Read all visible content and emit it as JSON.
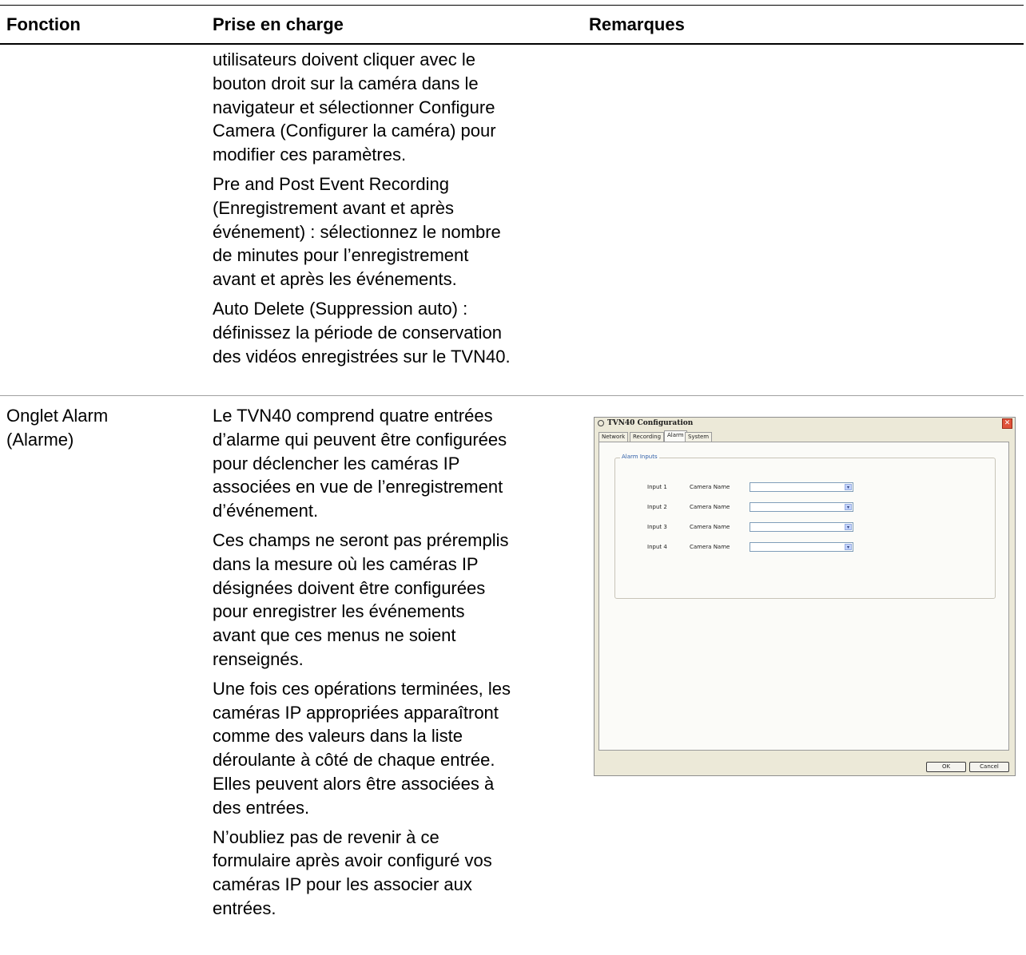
{
  "table": {
    "headers": {
      "fonction": "Fonction",
      "prise": "Prise en charge",
      "remarques": "Remarques"
    },
    "continued_row": {
      "prise_paragraphs": [
        [
          "utilisateurs doivent cliquer avec le",
          "bouton droit sur la caméra dans le",
          "navigateur et sélectionner Configure",
          "Camera (Configurer la caméra) pour",
          "modifier ces paramètres."
        ],
        [
          "Pre and Post Event Recording",
          "(Enregistrement avant et après",
          "événement) : sélectionnez le nombre",
          "de minutes pour l’enregistrement",
          "avant et après les événements."
        ],
        [
          "Auto Delete (Suppression auto) :",
          "définissez la période de conservation",
          "des vidéos enregistrées sur le TVN40."
        ]
      ]
    },
    "alarm_row": {
      "fonction_lines": [
        "Onglet Alarm",
        "(Alarme)"
      ],
      "prise_paragraphs": [
        [
          "Le TVN40 comprend quatre entrées",
          "d’alarme qui peuvent être configurées",
          "pour déclencher les caméras IP",
          "associées en vue de l’enregistrement",
          "d’événement."
        ],
        [
          "Ces champs ne seront pas préremplis",
          "dans la mesure où les caméras IP",
          "désignées doivent être configurées",
          "pour enregistrer les événements",
          "avant que ces menus ne soient",
          "renseignés."
        ],
        [
          "Une fois ces opérations terminées, les",
          "caméras IP appropriées apparaîtront",
          "comme des valeurs dans la liste",
          "déroulante à côté de chaque entrée.",
          "Elles peuvent alors être associées à",
          "des entrées."
        ],
        [
          "N’oubliez pas de revenir à ce",
          "formulaire après avoir configuré vos",
          "caméras IP pour les associer aux",
          "entrées."
        ]
      ]
    }
  },
  "dialog": {
    "title": "TVN40 Configuration",
    "close_glyph": "✕",
    "tabs": [
      "Network",
      "Recording",
      "Alarm",
      "System"
    ],
    "selected_tab": "Alarm",
    "group_label": "Alarm Inputs",
    "inputs": [
      {
        "label": "Input 1",
        "field": "Camera Name",
        "value": ""
      },
      {
        "label": "Input 2",
        "field": "Camera Name",
        "value": ""
      },
      {
        "label": "Input 3",
        "field": "Camera Name",
        "value": ""
      },
      {
        "label": "Input 4",
        "field": "Camera Name",
        "value": ""
      }
    ],
    "dropdown_glyph": "▾",
    "ok_label": "OK",
    "cancel_label": "Cancel"
  }
}
